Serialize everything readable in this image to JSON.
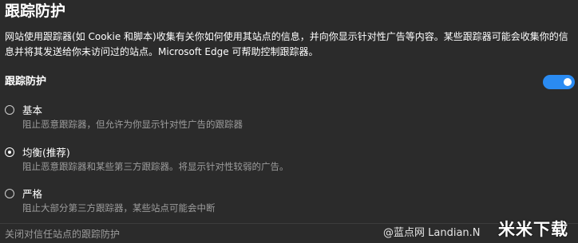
{
  "header": {
    "title": "跟踪防护"
  },
  "description": "网站使用跟踪器(如 Cookie 和脚本)收集有关你如何使用其站点的信息，并向你显示针对性广告等内容。某些跟踪器可能会收集你的信息并将其发送给你未访问过的站点。Microsoft Edge 可帮助控制跟踪器。",
  "tracking_section": {
    "label": "跟踪防护",
    "toggle_state": "on",
    "accent_color": "#2a8bf2"
  },
  "options": [
    {
      "label": "基本",
      "description": "阻止恶意跟踪器，但允许为你显示针对性广告的跟踪器",
      "selected": false
    },
    {
      "label": "均衡(推荐)",
      "description": "阻止恶意跟踪器和某些第三方跟踪器。将显示针对性较弱的广告。",
      "selected": true
    },
    {
      "label": "严格",
      "description": "阻止大部分第三方跟踪器，某些站点可能会中断",
      "selected": false
    }
  ],
  "footer": {
    "link_text": "关闭对信任站点的跟踪防护"
  },
  "watermark": {
    "text": "@蓝点网 Landian.N",
    "logo_text": "米米下载"
  }
}
